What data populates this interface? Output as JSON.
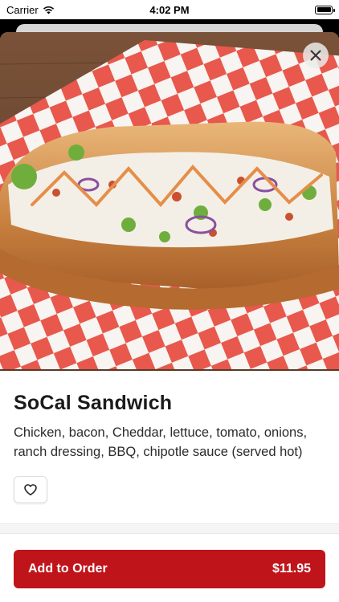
{
  "status_bar": {
    "carrier": "Carrier",
    "time": "4:02 PM"
  },
  "item": {
    "name": "SoCal Sandwich",
    "description": "Chicken, bacon, Cheddar, lettuce, tomato, onions, ranch dressing, BBQ, chipotle sauce (served hot)",
    "image_icon": "sandwich-photo"
  },
  "actions": {
    "close_icon": "close-icon",
    "favorite_icon": "heart-icon",
    "add_to_order_label": "Add to Order",
    "price": "$11.95"
  },
  "colors": {
    "accent": "#c0141b",
    "paper_red": "#e8584c"
  }
}
